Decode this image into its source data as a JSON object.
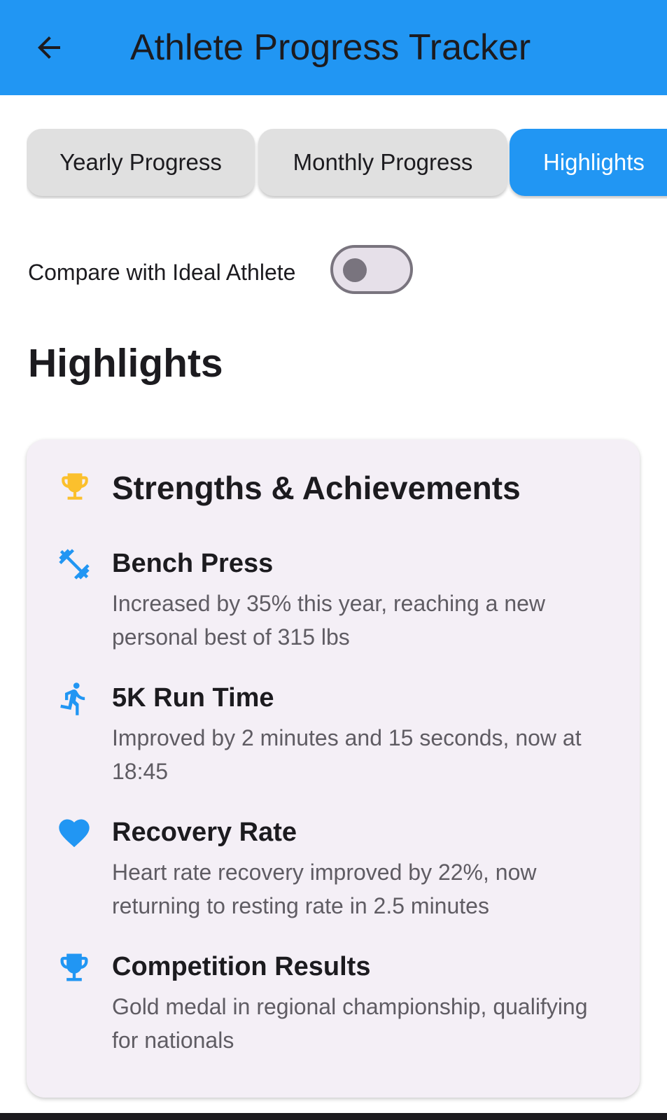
{
  "app_bar": {
    "title": "Athlete Progress Tracker",
    "back_icon": "arrow-back-icon",
    "color": "#2196f3"
  },
  "tabs": [
    {
      "label": "Yearly Progress",
      "active": false
    },
    {
      "label": "Monthly Progress",
      "active": false
    },
    {
      "label": "Highlights",
      "active": true
    }
  ],
  "compare": {
    "label": "Compare with Ideal Athlete",
    "enabled": false
  },
  "section": {
    "heading": "Highlights"
  },
  "card": {
    "icon": "trophy-icon",
    "icon_color": "#fbc02d",
    "title": "Strengths & Achievements",
    "items": [
      {
        "icon": "fitness-center-icon",
        "title": "Bench Press",
        "description": "Increased by 35% this year, reaching a new personal best of 315 lbs"
      },
      {
        "icon": "directions-run-icon",
        "title": "5K Run Time",
        "description": "Improved by 2 minutes and 15 seconds, now at 18:45"
      },
      {
        "icon": "heart-icon",
        "title": "Recovery Rate",
        "description": "Heart rate recovery improved by 22%, now returning to resting rate in 2.5 minutes"
      },
      {
        "icon": "trophy-icon",
        "title": "Competition Results",
        "description": "Gold medal in regional championship, qualifying for nationals"
      }
    ],
    "item_icon_color": "#2196f3"
  }
}
